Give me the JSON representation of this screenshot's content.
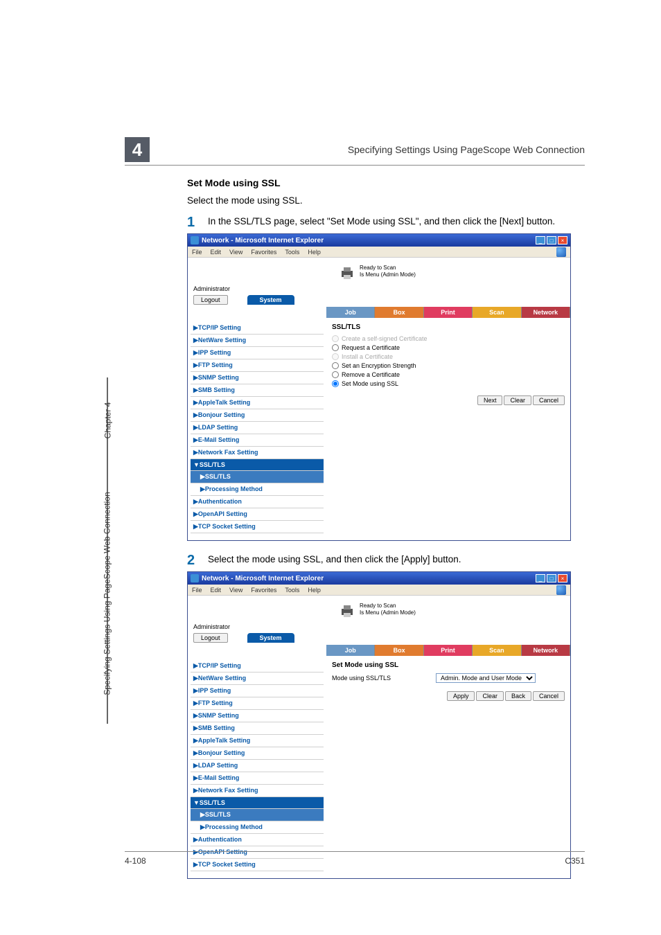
{
  "header": {
    "chapter_number": "4",
    "title": "Specifying Settings Using PageScope Web Connection"
  },
  "section": {
    "heading": "Set Mode using SSL",
    "intro": "Select the mode using SSL."
  },
  "steps": [
    {
      "num": "1",
      "text": "In the SSL/TLS page, select \"Set Mode using SSL\", and then click the [Next] button."
    },
    {
      "num": "2",
      "text": "Select the mode using SSL, and then click the [Apply] button."
    }
  ],
  "browser": {
    "title": "Network - Microsoft Internet Explorer",
    "menu": [
      "File",
      "Edit",
      "View",
      "Favorites",
      "Tools",
      "Help"
    ],
    "status_line1": "Ready to Scan",
    "status_line2": "Is Menu (Admin Mode)",
    "admin_label": "Administrator",
    "logout": "Logout",
    "system_tab": "System",
    "tabs": {
      "job": "Job",
      "box": "Box",
      "print": "Print",
      "scan": "Scan",
      "network": "Network"
    }
  },
  "sidebar": {
    "items": [
      "▶TCP/IP Setting",
      "▶NetWare Setting",
      "▶IPP Setting",
      "▶FTP Setting",
      "▶SNMP Setting",
      "▶SMB Setting",
      "▶AppleTalk Setting",
      "▶Bonjour Setting",
      "▶LDAP Setting",
      "▶E-Mail Setting",
      "▶Network Fax Setting"
    ],
    "ssl_group": "▼SSL/TLS",
    "ssl_sub1": "▶SSL/TLS",
    "ssl_sub2": "▶Processing Method",
    "items_bottom": [
      "▶Authentication",
      "▶OpenAPI Setting",
      "▶TCP Socket Setting"
    ]
  },
  "pane1": {
    "heading": "SSL/TLS",
    "options": [
      "Create a self-signed Certificate",
      "Request a Certificate",
      "Install a Certificate",
      "Set an Encryption Strength",
      "Remove a Certificate",
      "Set Mode using SSL"
    ],
    "buttons": {
      "next": "Next",
      "clear": "Clear",
      "cancel": "Cancel"
    }
  },
  "pane2": {
    "heading": "Set Mode using SSL",
    "row_label": "Mode using SSL/TLS",
    "select_value": "Admin. Mode and User Mode",
    "buttons": {
      "apply": "Apply",
      "clear": "Clear",
      "back": "Back",
      "cancel": "Cancel"
    }
  },
  "side_tab": {
    "chapter": "Chapter 4",
    "title": "Specifying Settings Using PageScope Web Connection"
  },
  "footer": {
    "page": "4-108",
    "model": "C351"
  }
}
